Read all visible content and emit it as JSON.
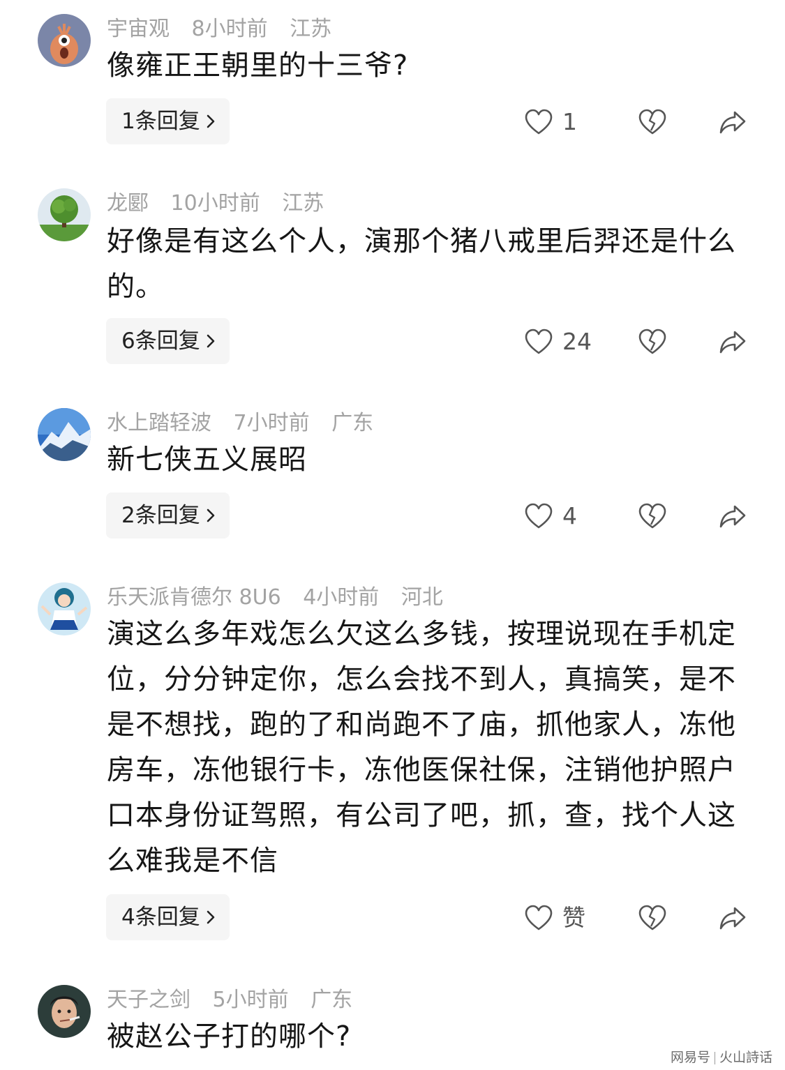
{
  "comments": [
    {
      "username": "宇宙观",
      "time": "8小时前",
      "location": "江苏",
      "text": "像雍正王朝里的十三爷?",
      "replies_label": "1条回复",
      "like_count": "1"
    },
    {
      "username": "龙郾",
      "time": "10小时前",
      "location": "江苏",
      "text": "好像是有这么个人，演那个猪八戒里后羿还是什么的。",
      "replies_label": "6条回复",
      "like_count": "24"
    },
    {
      "username": "水上踏轻波",
      "time": "7小时前",
      "location": "广东",
      "text": "新七侠五义展昭",
      "replies_label": "2条回复",
      "like_count": "4"
    },
    {
      "username": "乐天派肯德尔 8U6",
      "time": "4小时前",
      "location": "河北",
      "text": "演这么多年戏怎么欠这么多钱，按理说现在手机定位，分分钟定你，怎么会找不到人，真搞笑，是不是不想找，跑的了和尚跑不了庙，抓他家人，冻他房车，冻他银行卡，冻他医保社保，注销他护照户口本身份证驾照，有公司了吧，抓，查，找个人这么难我是不信",
      "replies_label": "4条回复",
      "like_count": "赞"
    },
    {
      "username": "天子之剑",
      "time": "5小时前",
      "location": "广东",
      "text": "被赵公子打的哪个?"
    }
  ],
  "icons": {
    "like": "heart-outline-icon",
    "dislike": "broken-heart-icon",
    "share": "share-arrow-icon",
    "chevron": "chevron-right-icon"
  },
  "colors": {
    "meta_text": "#a3a3a3",
    "body_text": "#161616",
    "reply_bg": "#f5f5f5"
  },
  "watermark": {
    "left": "网易号",
    "right": "火山詩话"
  }
}
